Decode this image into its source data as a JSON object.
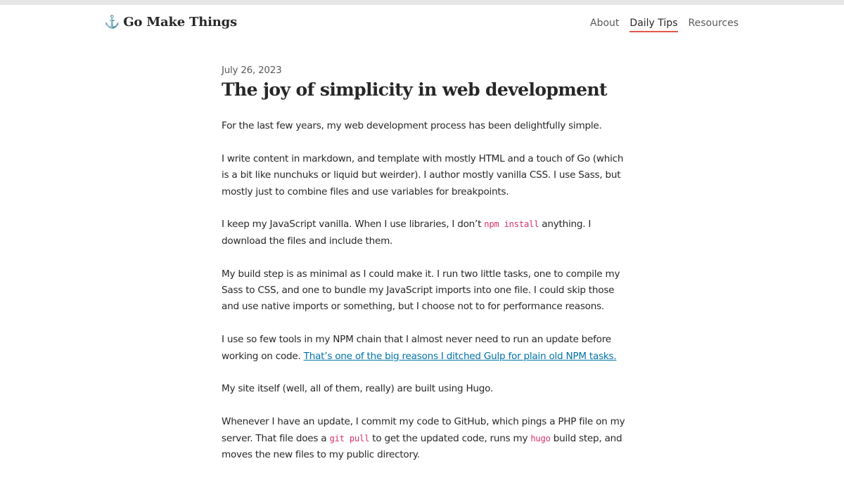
{
  "site": {
    "logo_icon": "⚓",
    "logo_text": "Go Make Things"
  },
  "nav": {
    "items": [
      {
        "label": "About"
      },
      {
        "label": "Daily Tips"
      },
      {
        "label": "Resources"
      }
    ],
    "active": "Daily Tips"
  },
  "article": {
    "date": "July 26, 2023",
    "title": "The joy of simplicity in web development",
    "p1": "For the last few years, my web development process has been delightfully simple.",
    "p2": "I write content in markdown, and template with mostly HTML and a touch of Go (which is a bit like nunchuks or liquid but weirder). I author mostly vanilla CSS. I use Sass, but mostly just to combine files and use variables for breakpoints.",
    "p3": {
      "before": "I keep my JavaScript vanilla. When I use libraries, I don’t ",
      "code": "npm install",
      "after": " anything. I download the files and include them."
    },
    "p4": "My build step is as minimal as I could make it. I run two little tasks, one to compile my Sass to CSS, and one to bundle my JavaScript imports into one file. I could skip those and use native imports or something, but I choose not to for performance reasons.",
    "p5": {
      "before": "I use so few tools in my NPM chain that I almost never need to run an update before working on code. ",
      "link": "That’s one of the big reasons I ditched Gulp for plain old NPM tasks."
    },
    "p6": "My site itself (well, all of them, really) are built using Hugo.",
    "p7": {
      "before": "Whenever I have an update, I commit my code to GitHub, which pings a PHP file on my server. That file does a ",
      "code1": "git pull",
      "middle": " to get the updated code, runs my ",
      "code2": "hugo",
      "after": " build step, and moves the new files to my public directory."
    }
  },
  "colors": {
    "accent": "#e2574c",
    "link": "#0073aa",
    "code": "#d6336c",
    "topbar": "#e6e6e6"
  }
}
